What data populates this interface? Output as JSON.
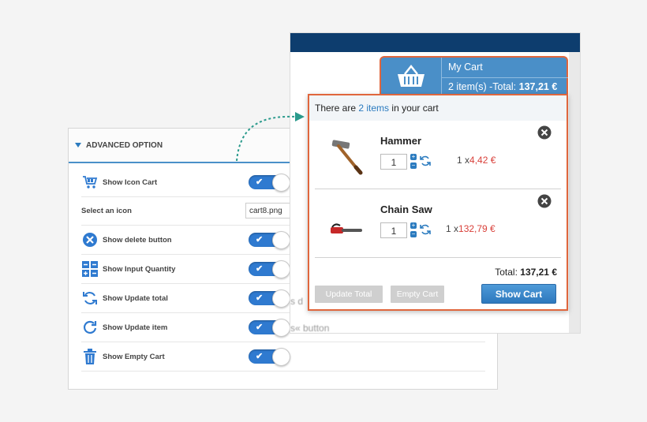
{
  "admin": {
    "section_title": "ADVANCED OPTION",
    "options": [
      {
        "label": "Show Icon Cart",
        "icon": "cart-icon",
        "enabled": true
      },
      {
        "label": "Select an icon",
        "value": "cart8.png"
      },
      {
        "label": "Show delete button",
        "icon": "delete-icon",
        "enabled": true
      },
      {
        "label": "Show Input Quantity",
        "icon": "quantity-icon",
        "enabled": true
      },
      {
        "label": "Show Update total",
        "icon": "refresh-icon",
        "enabled": true
      },
      {
        "label": "Show Update item",
        "icon": "update-item-icon",
        "enabled": true
      },
      {
        "label": "Show Empty Cart",
        "icon": "trash-icon",
        "enabled": true
      }
    ]
  },
  "store": {
    "bg_text_1": "s d",
    "bg_text_2": "s« button"
  },
  "cart": {
    "tab_title": "My Cart",
    "tab_summary": "2 item(s) -Total:",
    "tab_total": "137,21 €",
    "head_prefix": "There are",
    "head_link": "2 items",
    "head_suffix": "in your cart",
    "items": [
      {
        "name": "Hammer",
        "qty": "1",
        "qty_prefix": "1 x",
        "price": "4,42 €"
      },
      {
        "name": "Chain Saw",
        "qty": "1",
        "qty_prefix": "1 x",
        "price": "132,79 €"
      }
    ],
    "total_label": "Total:",
    "total_value": "137,21 €",
    "btn_update_total": "Update Total",
    "btn_empty_cart": "Empty Cart",
    "btn_show_cart": "Show Cart"
  },
  "colors": {
    "accent": "#2f7ad0",
    "highlight_border": "#e0663d",
    "price_red": "#d9403a"
  }
}
